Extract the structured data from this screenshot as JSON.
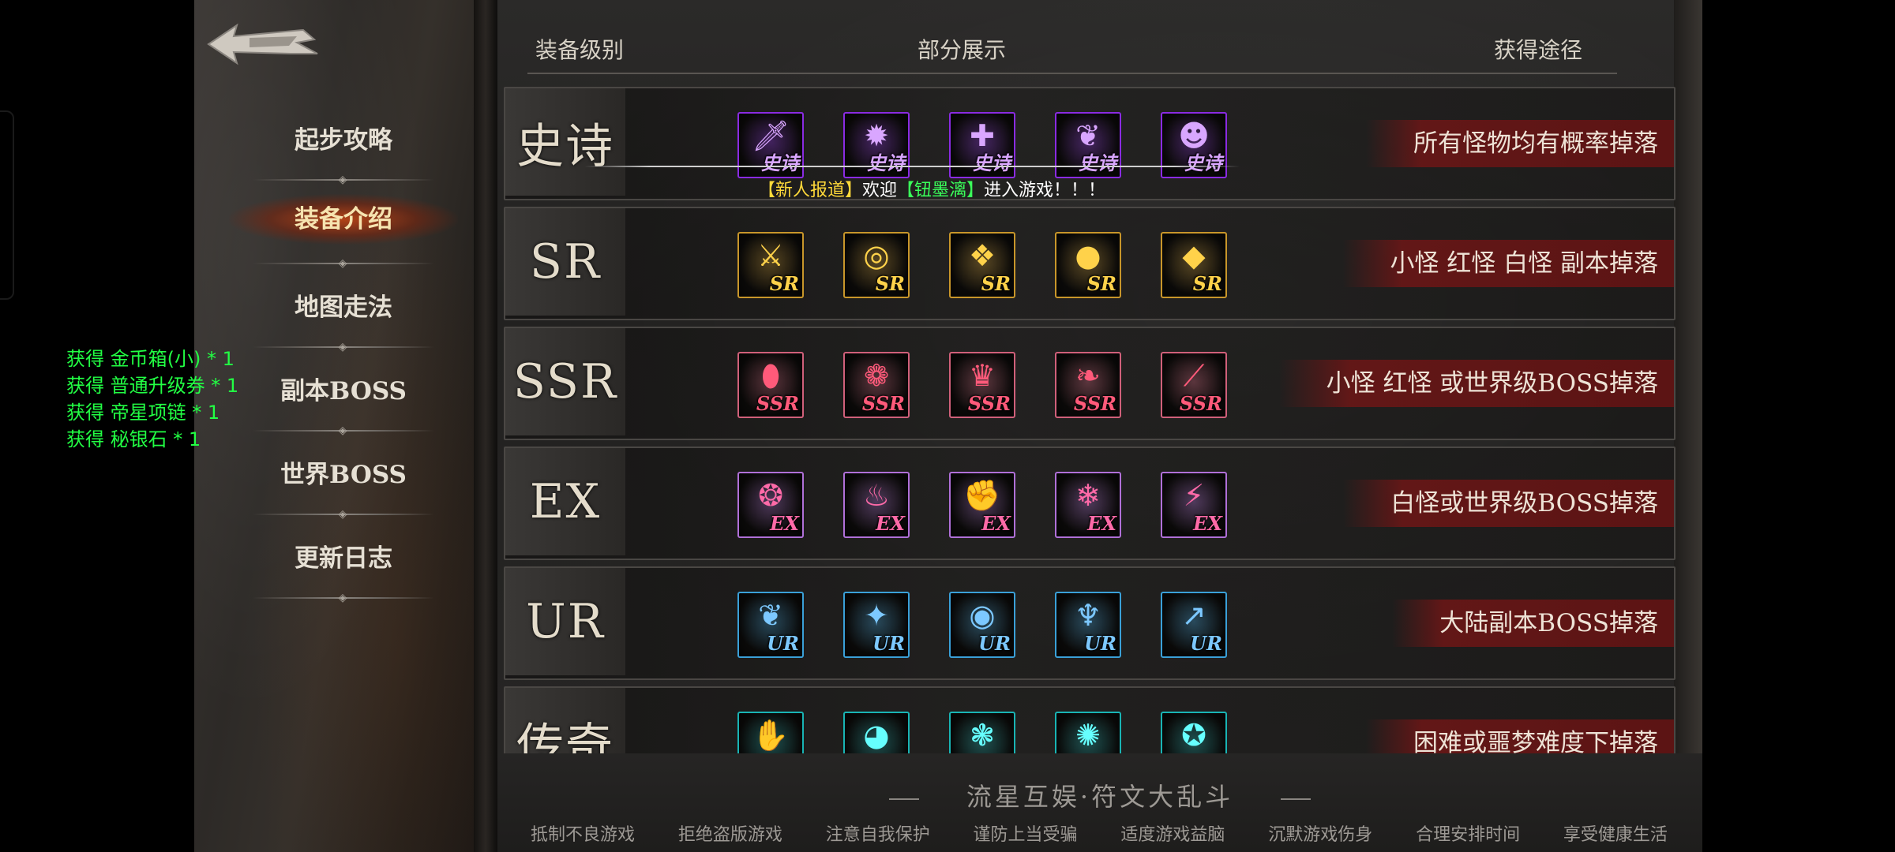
{
  "nav": {
    "items": [
      {
        "label": "起步攻略",
        "active": false
      },
      {
        "label": "装备介绍",
        "active": true
      },
      {
        "label": "地图走法",
        "active": false
      },
      {
        "label": "副本BOSS",
        "active": false
      },
      {
        "label": "世界BOSS",
        "active": false
      },
      {
        "label": "更新日志",
        "active": false
      }
    ]
  },
  "table": {
    "headers": {
      "level": "装备级别",
      "showcase": "部分展示",
      "source": "获得途径"
    },
    "rows": [
      {
        "grade": "史诗",
        "tag": "史诗",
        "border": "#8a2be2",
        "tagColor": "#d9a6ff",
        "icons": [
          "sword-icon",
          "sun-amulet-icon",
          "cross-emblem-icon",
          "winged-crest-icon",
          "demon-mask-icon"
        ],
        "glyphs": [
          "🗡",
          "✹",
          "✚",
          "❦",
          "☻"
        ],
        "source": "所有怪物均有概率掉落"
      },
      {
        "grade": "SR",
        "tag": "SR",
        "border": "#c8962a",
        "tagColor": "#ffd24a",
        "icons": [
          "crossed-blades-icon",
          "ring-icon",
          "scroll-icon",
          "coin-amulet-icon",
          "emerald-brooch-icon"
        ],
        "glyphs": [
          "⚔",
          "◎",
          "❖",
          "●",
          "◆"
        ],
        "source": "小怪 红怪 白怪 副本掉落"
      },
      {
        "grade": "SSR",
        "tag": "SSR",
        "border": "#d0607a",
        "tagColor": "#ff5a7a",
        "icons": [
          "gem-necklace-icon",
          "gold-ornament-icon",
          "ruby-crown-icon",
          "angel-wings-icon",
          "flame-staff-icon"
        ],
        "glyphs": [
          "⬮",
          "❁",
          "♛",
          "❧",
          "⟋"
        ],
        "source": "小怪 红怪 或世界级BOSS掉落"
      },
      {
        "grade": "EX",
        "tag": "EX",
        "border": "#b070d8",
        "tagColor": "#ff6aa8",
        "icons": [
          "pendant-icon",
          "fire-bowl-icon",
          "gauntlet-icon",
          "blue-claw-icon",
          "red-blade-icon"
        ],
        "glyphs": [
          "❂",
          "♨",
          "✊",
          "❄",
          "⚡"
        ],
        "source": "白怪或世界级BOSS掉落"
      },
      {
        "grade": "UR",
        "tag": "UR",
        "border": "#3aa0d8",
        "tagColor": "#7cc8ff",
        "icons": [
          "golden-feather-icon",
          "blue-star-icon",
          "fire-orb-icon",
          "dragon-icon",
          "spear-icon"
        ],
        "glyphs": [
          "❦",
          "✦",
          "◉",
          "♆",
          "↗"
        ],
        "source": "大陆副本BOSS掉落"
      },
      {
        "grade": "传奇",
        "tag": "",
        "border": "#19b4b4",
        "tagColor": "#6ff",
        "icons": [
          "fire-hand-icon",
          "eye-icon",
          "blue-rune-icon",
          "red-shield-icon",
          "blue-orb-icon"
        ],
        "glyphs": [
          "✋",
          "◕",
          "❃",
          "✺",
          "✪"
        ],
        "source": "困难或噩梦难度下掉落"
      }
    ]
  },
  "notice": {
    "prefix": "【新人报道】",
    "welcome": "欢迎",
    "player": "【钮墨漓】",
    "suffix": "进入游戏！！！"
  },
  "loot_log": [
    "获得 金币箱(小) * 1",
    "获得 普通升级券 * 1",
    "获得 帝星项链 * 1",
    "获得 秘银石 * 1"
  ],
  "footer": {
    "title": "流星互娱·符文大乱斗",
    "links": [
      "抵制不良游戏",
      "拒绝盗版游戏",
      "注意自我保护",
      "谨防上当受骗",
      "适度游戏益脑",
      "沉默游戏伤身",
      "合理安排时间",
      "享受健康生活"
    ]
  }
}
